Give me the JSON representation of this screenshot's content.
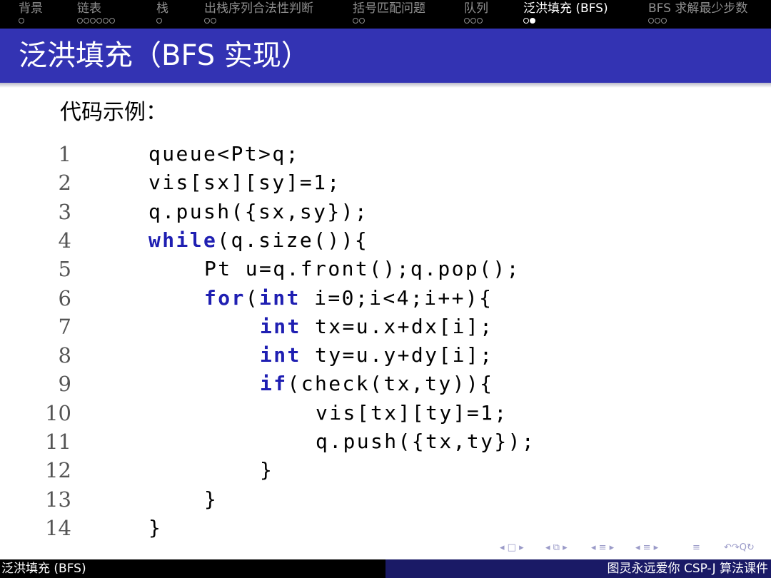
{
  "nav": {
    "sections": [
      {
        "label": "背景",
        "dots": 1,
        "active_dot": -1
      },
      {
        "label": "链表",
        "dots": 6,
        "active_dot": -1
      },
      {
        "label": "栈",
        "dots": 1,
        "active_dot": -1
      },
      {
        "label": "出栈序列合法性判断",
        "dots": 2,
        "active_dot": -1
      },
      {
        "label": "括号匹配问题",
        "dots": 2,
        "active_dot": -1
      },
      {
        "label": "队列",
        "dots": 3,
        "active_dot": -1
      },
      {
        "label": "泛洪填充 (BFS)",
        "dots": 2,
        "active_dot": 1
      },
      {
        "label": "BFS 求解最少步数",
        "dots": 3,
        "active_dot": -1
      }
    ],
    "active_section": 6
  },
  "slide": {
    "title": "泛洪填充（BFS 实现）",
    "intro": "代码示例："
  },
  "code_lines": [
    {
      "num": "1",
      "indent": 0,
      "parts": [
        {
          "t": "queue<Pt>q;"
        }
      ]
    },
    {
      "num": "2",
      "indent": 0,
      "parts": [
        {
          "t": "vis[sx][sy]=1;"
        }
      ]
    },
    {
      "num": "3",
      "indent": 0,
      "parts": [
        {
          "t": "q.push({sx,sy});"
        }
      ]
    },
    {
      "num": "4",
      "indent": 0,
      "parts": [
        {
          "t": "while",
          "kw": true
        },
        {
          "t": "(q.size()){"
        }
      ]
    },
    {
      "num": "5",
      "indent": 1,
      "parts": [
        {
          "t": "Pt u=q.front();q.pop();"
        }
      ]
    },
    {
      "num": "6",
      "indent": 1,
      "parts": [
        {
          "t": "for",
          "kw": true
        },
        {
          "t": "("
        },
        {
          "t": "int",
          "kw": true
        },
        {
          "t": " i=0;i<4;i++){"
        }
      ]
    },
    {
      "num": "7",
      "indent": 2,
      "parts": [
        {
          "t": "int",
          "kw": true
        },
        {
          "t": " tx=u.x+dx[i];"
        }
      ]
    },
    {
      "num": "8",
      "indent": 2,
      "parts": [
        {
          "t": "int",
          "kw": true
        },
        {
          "t": " ty=u.y+dy[i];"
        }
      ]
    },
    {
      "num": "9",
      "indent": 2,
      "parts": [
        {
          "t": "if",
          "kw": true
        },
        {
          "t": "(check(tx,ty)){"
        }
      ]
    },
    {
      "num": "10",
      "indent": 3,
      "parts": [
        {
          "t": "vis[tx][ty]=1;"
        }
      ]
    },
    {
      "num": "11",
      "indent": 3,
      "parts": [
        {
          "t": "q.push({tx,ty});"
        }
      ]
    },
    {
      "num": "12",
      "indent": 2,
      "parts": [
        {
          "t": "}"
        }
      ]
    },
    {
      "num": "13",
      "indent": 1,
      "parts": [
        {
          "t": "}"
        }
      ]
    },
    {
      "num": "14",
      "indent": 0,
      "parts": [
        {
          "t": "}"
        }
      ]
    }
  ],
  "footer": {
    "left": "泛洪填充 (BFS)",
    "right": "图灵永远爱你 CSP-J 算法课件"
  },
  "beamer_nav": [
    "◂ □ ▸",
    "◂ ⧉ ▸",
    "◂ ≡ ▸",
    "◂ ≡ ▸",
    "≡",
    "↶↷Q↻"
  ],
  "colors": {
    "title_bar": "#3333b3",
    "keyword": "#1f1fb2",
    "footer_right": "#1a1a66",
    "nav_inactive": "#8d8d8d"
  }
}
